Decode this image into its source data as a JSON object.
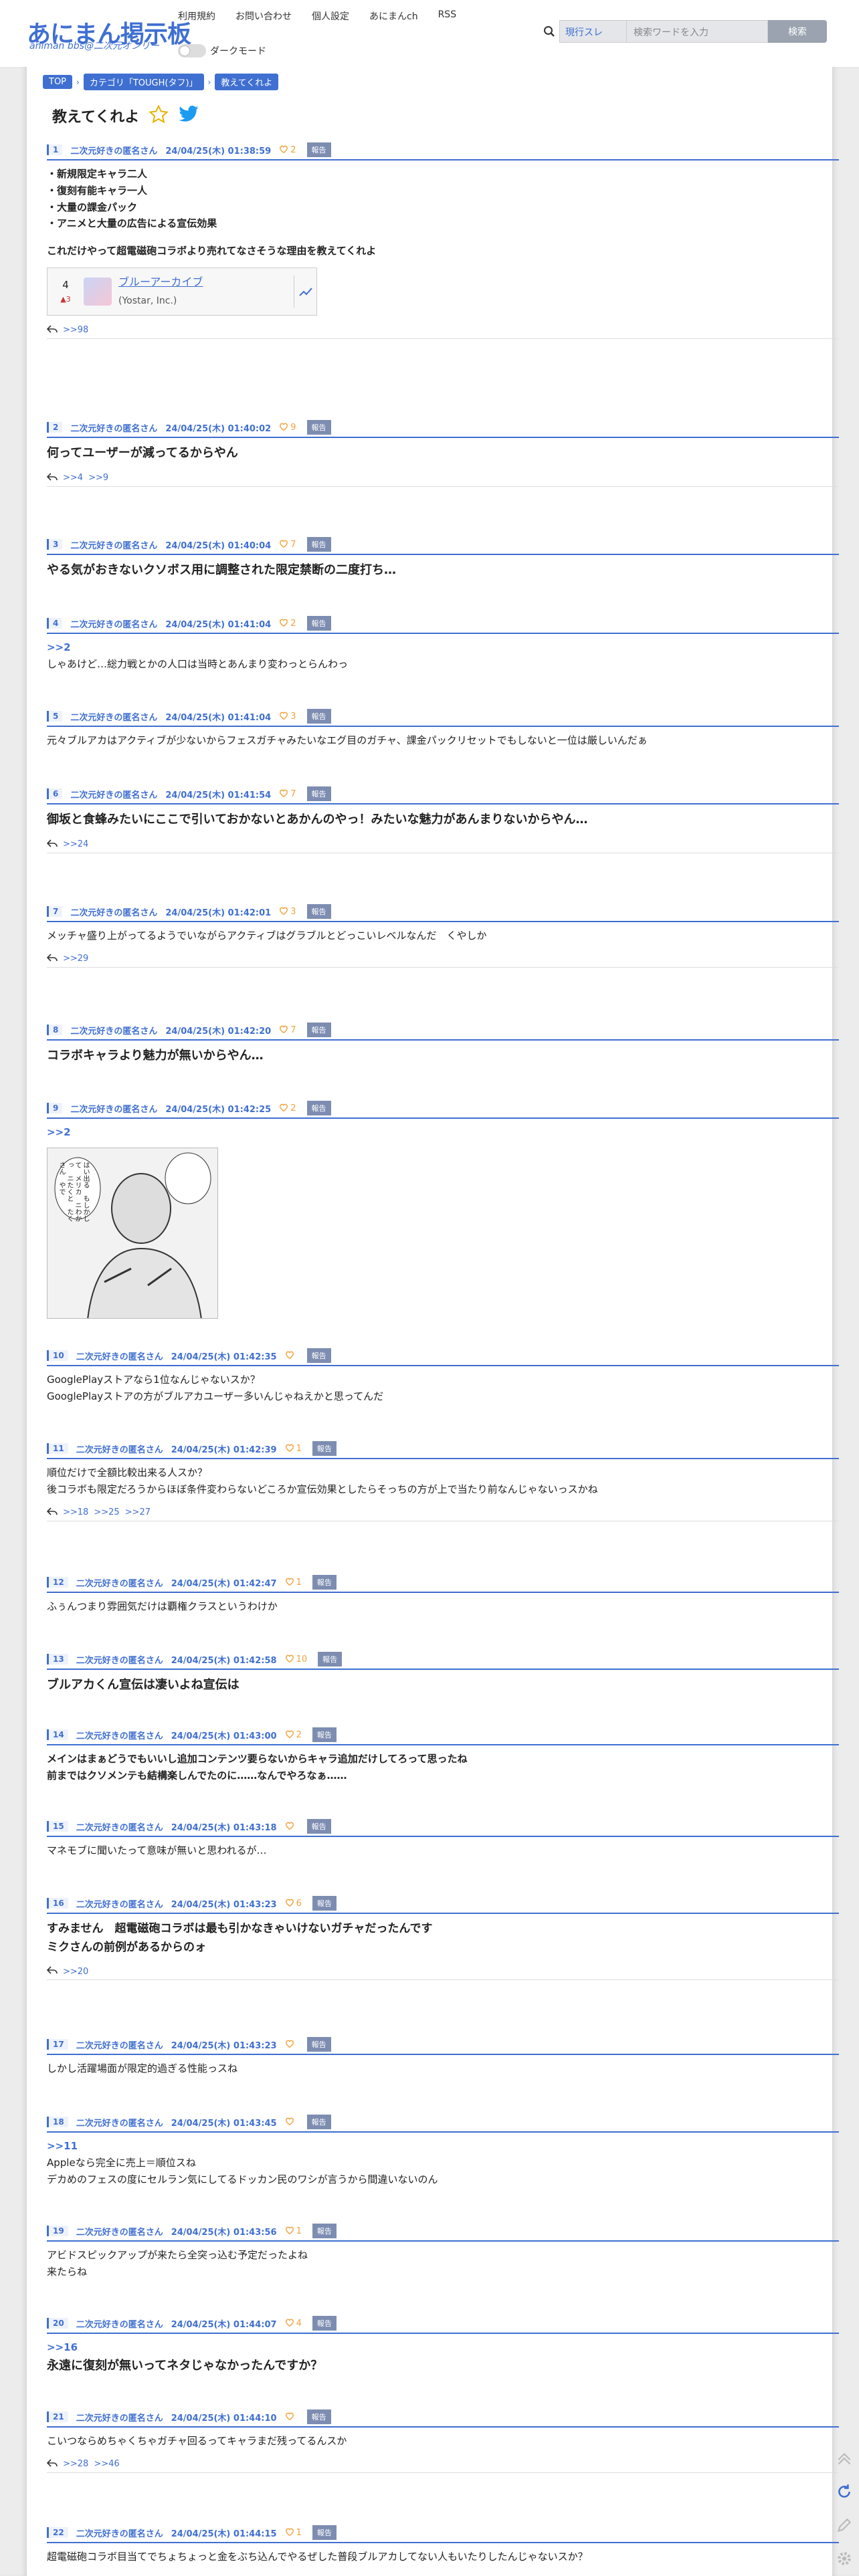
{
  "header": {
    "logo": "あにまん掲示板",
    "logo_sub": "animan bbs@二次元オンリー",
    "nav": [
      "利用規約",
      "お問い合わせ",
      "個人設定",
      "あにまんch",
      "RSS"
    ],
    "dark_mode": "ダークモード",
    "search": {
      "select": "現行スレ",
      "placeholder": "検索ワードを入力",
      "button": "検索"
    }
  },
  "breadcrumb": [
    "TOP",
    "カテゴリ「TOUGH(タフ)」",
    "教えてくれよ"
  ],
  "thread_title": "教えてくれよ",
  "posts": [
    {
      "num": "1",
      "name": "二次元好きの匿名さん",
      "date": "24/04/25(木) 01:38:59",
      "likes": "2",
      "report": "報告",
      "lines": [
        "・新規限定キャラ二人",
        "・復刻有能キャラ一人",
        "・大量の課金パック",
        "・アニメと大量の広告による宣伝効果",
        "",
        "これだけやって超電磁砲コラボより売れてなさそうな理由を教えてくれよ"
      ],
      "card": {
        "rank": "4",
        "change": "▲3",
        "title": "ブルーアーカイブ",
        "company": "(Yostar, Inc.)"
      },
      "replies": [
        ">>98"
      ]
    },
    {
      "num": "2",
      "name": "二次元好きの匿名さん",
      "date": "24/04/25(木) 01:40:02",
      "likes": "9",
      "report": "報告",
      "big": "何ってユーザーが減ってるからやん",
      "replies": [
        ">>4",
        ">>9"
      ]
    },
    {
      "num": "3",
      "name": "二次元好きの匿名さん",
      "date": "24/04/25(木) 01:40:04",
      "likes": "7",
      "report": "報告",
      "big": "やる気がおきないクソボス用に調整された限定禁断の二度打ち…"
    },
    {
      "num": "4",
      "name": "二次元好きの匿名さん",
      "date": "24/04/25(木) 01:41:04",
      "likes": "2",
      "report": "報告",
      "anchor": ">>2",
      "lines": [
        "しゃあけど…総力戦とかの人口は当時とあんまり変わっとらんわっ"
      ]
    },
    {
      "num": "5",
      "name": "二次元好きの匿名さん",
      "date": "24/04/25(木) 01:41:04",
      "likes": "3",
      "report": "報告",
      "lines": [
        "元々ブルアカはアクティブが少ないからフェスガチャみたいなエグ目のガチャ、課金パックリセットでもしないと一位は厳しいんだぁ"
      ]
    },
    {
      "num": "6",
      "name": "二次元好きの匿名さん",
      "date": "24/04/25(木) 01:41:54",
      "likes": "7",
      "report": "報告",
      "big": "御坂と食蜂みたいにここで引いておかないとあかんのやっ！みたいな魅力があんまりないからやん…",
      "replies": [
        ">>24"
      ]
    },
    {
      "num": "7",
      "name": "二次元好きの匿名さん",
      "date": "24/04/25(木) 01:42:01",
      "likes": "3",
      "report": "報告",
      "lines": [
        "メッチャ盛り上がってるようでいながらアクティブはグラブルとどっこいレベルなんだ　くやしか"
      ],
      "replies": [
        ">>29"
      ]
    },
    {
      "num": "8",
      "name": "二次元好きの匿名さん",
      "date": "24/04/25(木) 01:42:20",
      "likes": "7",
      "report": "報告",
      "big": "コラボキャラより魅力が無いからやん…"
    },
    {
      "num": "9",
      "name": "二次元好きの匿名さん",
      "date": "24/04/25(木) 01:42:25",
      "likes": "2",
      "report": "報告",
      "anchor": ">>2",
      "manga": "はい出る　もしかして　メリカ　ニわかっ　ニたくと　たくさん　やで"
    },
    {
      "num": "10",
      "name": "二次元好きの匿名さん",
      "date": "24/04/25(木) 01:42:35",
      "likes": "",
      "report": "報告",
      "lines": [
        "GooglePlayストアなら1位なんじゃないスか？",
        "GooglePlayストアの方がブルアカユーザー多いんじゃねえかと思ってんだ"
      ]
    },
    {
      "num": "11",
      "name": "二次元好きの匿名さん",
      "date": "24/04/25(木) 01:42:39",
      "likes": "1",
      "report": "報告",
      "lines": [
        "順位だけで全額比較出来る人スか？",
        "後コラボも限定だろうからほぼ条件変わらないどころか宣伝効果としたらそっちの方が上で当たり前なんじゃないっスかね"
      ],
      "replies": [
        ">>18",
        ">>25",
        ">>27"
      ]
    },
    {
      "num": "12",
      "name": "二次元好きの匿名さん",
      "date": "24/04/25(木) 01:42:47",
      "likes": "1",
      "report": "報告",
      "lines": [
        "ふぅんつまり雰囲気だけは覇権クラスというわけか"
      ]
    },
    {
      "num": "13",
      "name": "二次元好きの匿名さん",
      "date": "24/04/25(木) 01:42:58",
      "likes": "10",
      "report": "報告",
      "big": "ブルアカくん宣伝は凄いよね宣伝は"
    },
    {
      "num": "14",
      "name": "二次元好きの匿名さん",
      "date": "24/04/25(木) 01:43:00",
      "likes": "2",
      "report": "報告",
      "bold": [
        "メインはまぁどうでもいいし追加コンテンツ要らないからキャラ追加だけしてろって思ったね",
        "前まではクソメンテも結構楽しんでたのに……なんでやろなぁ……"
      ]
    },
    {
      "num": "15",
      "name": "二次元好きの匿名さん",
      "date": "24/04/25(木) 01:43:18",
      "likes": "",
      "report": "報告",
      "lines": [
        "マネモブに聞いたって意味が無いと思われるが…"
      ]
    },
    {
      "num": "16",
      "name": "二次元好きの匿名さん",
      "date": "24/04/25(木) 01:43:23",
      "likes": "6",
      "report": "報告",
      "bigl": [
        "すみません　超電磁砲コラボは最も引かなきゃいけないガチャだったんです",
        "ミクさんの前例があるからのォ"
      ],
      "replies": [
        ">>20"
      ]
    },
    {
      "num": "17",
      "name": "二次元好きの匿名さん",
      "date": "24/04/25(木) 01:43:23",
      "likes": "",
      "report": "報告",
      "lines": [
        "しかし活躍場面が限定的過ぎる性能っスね"
      ]
    },
    {
      "num": "18",
      "name": "二次元好きの匿名さん",
      "date": "24/04/25(木) 01:43:45",
      "likes": "",
      "report": "報告",
      "anchor": ">>11",
      "lines": [
        "Appleなら完全に売上＝順位スね",
        "デカめのフェスの度にセルラン気にしてるドッカン民のワシが言うから間違いないのん"
      ]
    },
    {
      "num": "19",
      "name": "二次元好きの匿名さん",
      "date": "24/04/25(木) 01:43:56",
      "likes": "1",
      "report": "報告",
      "lines": [
        "アビドスピックアップが来たら全突っ込む予定だったよね",
        "来たらね"
      ]
    },
    {
      "num": "20",
      "name": "二次元好きの匿名さん",
      "date": "24/04/25(木) 01:44:07",
      "likes": "4",
      "report": "報告",
      "anchor": ">>16",
      "big": "永遠に復刻が無いってネタじゃなかったんですか？"
    },
    {
      "num": "21",
      "name": "二次元好きの匿名さん",
      "date": "24/04/25(木) 01:44:10",
      "likes": "",
      "report": "報告",
      "lines": [
        "こいつならめちゃくちゃガチャ回るってキャラまだ残ってるんスか"
      ],
      "replies": [
        ">>28",
        ">>46"
      ]
    },
    {
      "num": "22",
      "name": "二次元好きの匿名さん",
      "date": "24/04/25(木) 01:44:15",
      "likes": "1",
      "report": "報告",
      "lines": [
        "超電磁砲コラボ目当てでちょちょっと金をぶち込んでやるぜした普段ブルアカしてない人もいたりしたんじゃないスか？"
      ]
    }
  ],
  "colors": {
    "accent": "#3f6fd1",
    "like": "#f0a23a",
    "report": "#7d8db1"
  }
}
